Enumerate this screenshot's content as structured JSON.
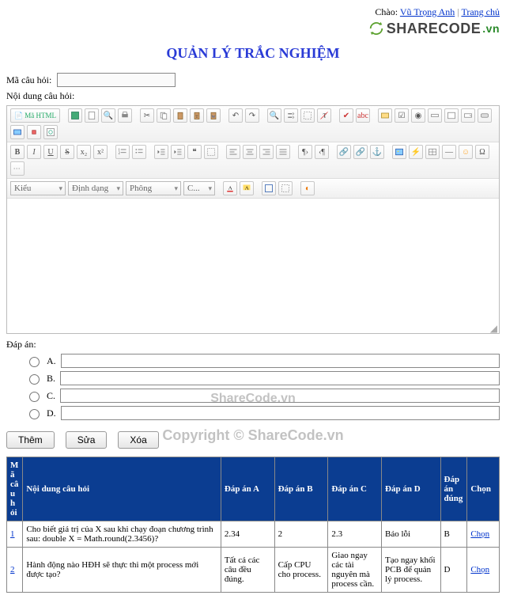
{
  "topbar": {
    "greeting_prefix": "Chào:",
    "user_link": "Vũ Trọng Anh",
    "home_link": "Trang chủ"
  },
  "brand": {
    "name": "SHARECODE",
    "tld": ".vn"
  },
  "page_title": "QUẢN LÝ TRẮC NGHIỆM",
  "labels": {
    "code": "Mã câu hỏi:",
    "body": "Nội dung câu hỏi:",
    "answers": "Đáp án:",
    "ma_html": "Mã HTML"
  },
  "selects": {
    "style": "Kiểu",
    "format": "Định dạng",
    "font": "Phông",
    "size": "C..."
  },
  "answer_letters": [
    "A.",
    "B.",
    "C.",
    "D."
  ],
  "buttons": {
    "add": "Thêm",
    "edit": "Sửa",
    "del": "Xóa"
  },
  "table": {
    "headers": {
      "idx": "Mã câu hỏi",
      "body": "Nội dung câu hỏi",
      "a": "Đáp án A",
      "b": "Đáp án B",
      "c": "Đáp án C",
      "d": "Đáp án D",
      "correct": "Đáp án đúng",
      "select": "Chọn"
    },
    "rows": [
      {
        "idx": "1",
        "body": "Cho biết giá trị của X sau khi chạy đoạn chương trình sau: double X = Math.round(2.3456)?",
        "a": "2.34",
        "b": "2",
        "c": "2.3",
        "d": "Báo lỗi",
        "correct": "B",
        "select": "Chọn"
      },
      {
        "idx": "2",
        "body": "Hành động nào HĐH sẽ thực thi một process mới được tạo?",
        "a": "Tất cả các câu đều đúng.",
        "b": "Cấp CPU cho process.",
        "c": "Giao ngay các tài nguyên mà process cần.",
        "d": "Tạo ngay khối PCB để quản lý process.",
        "correct": "D",
        "select": "Chọn"
      }
    ]
  },
  "watermarks": {
    "a": "ShareCode.vn",
    "b": "Copyright © ShareCode.vn"
  }
}
